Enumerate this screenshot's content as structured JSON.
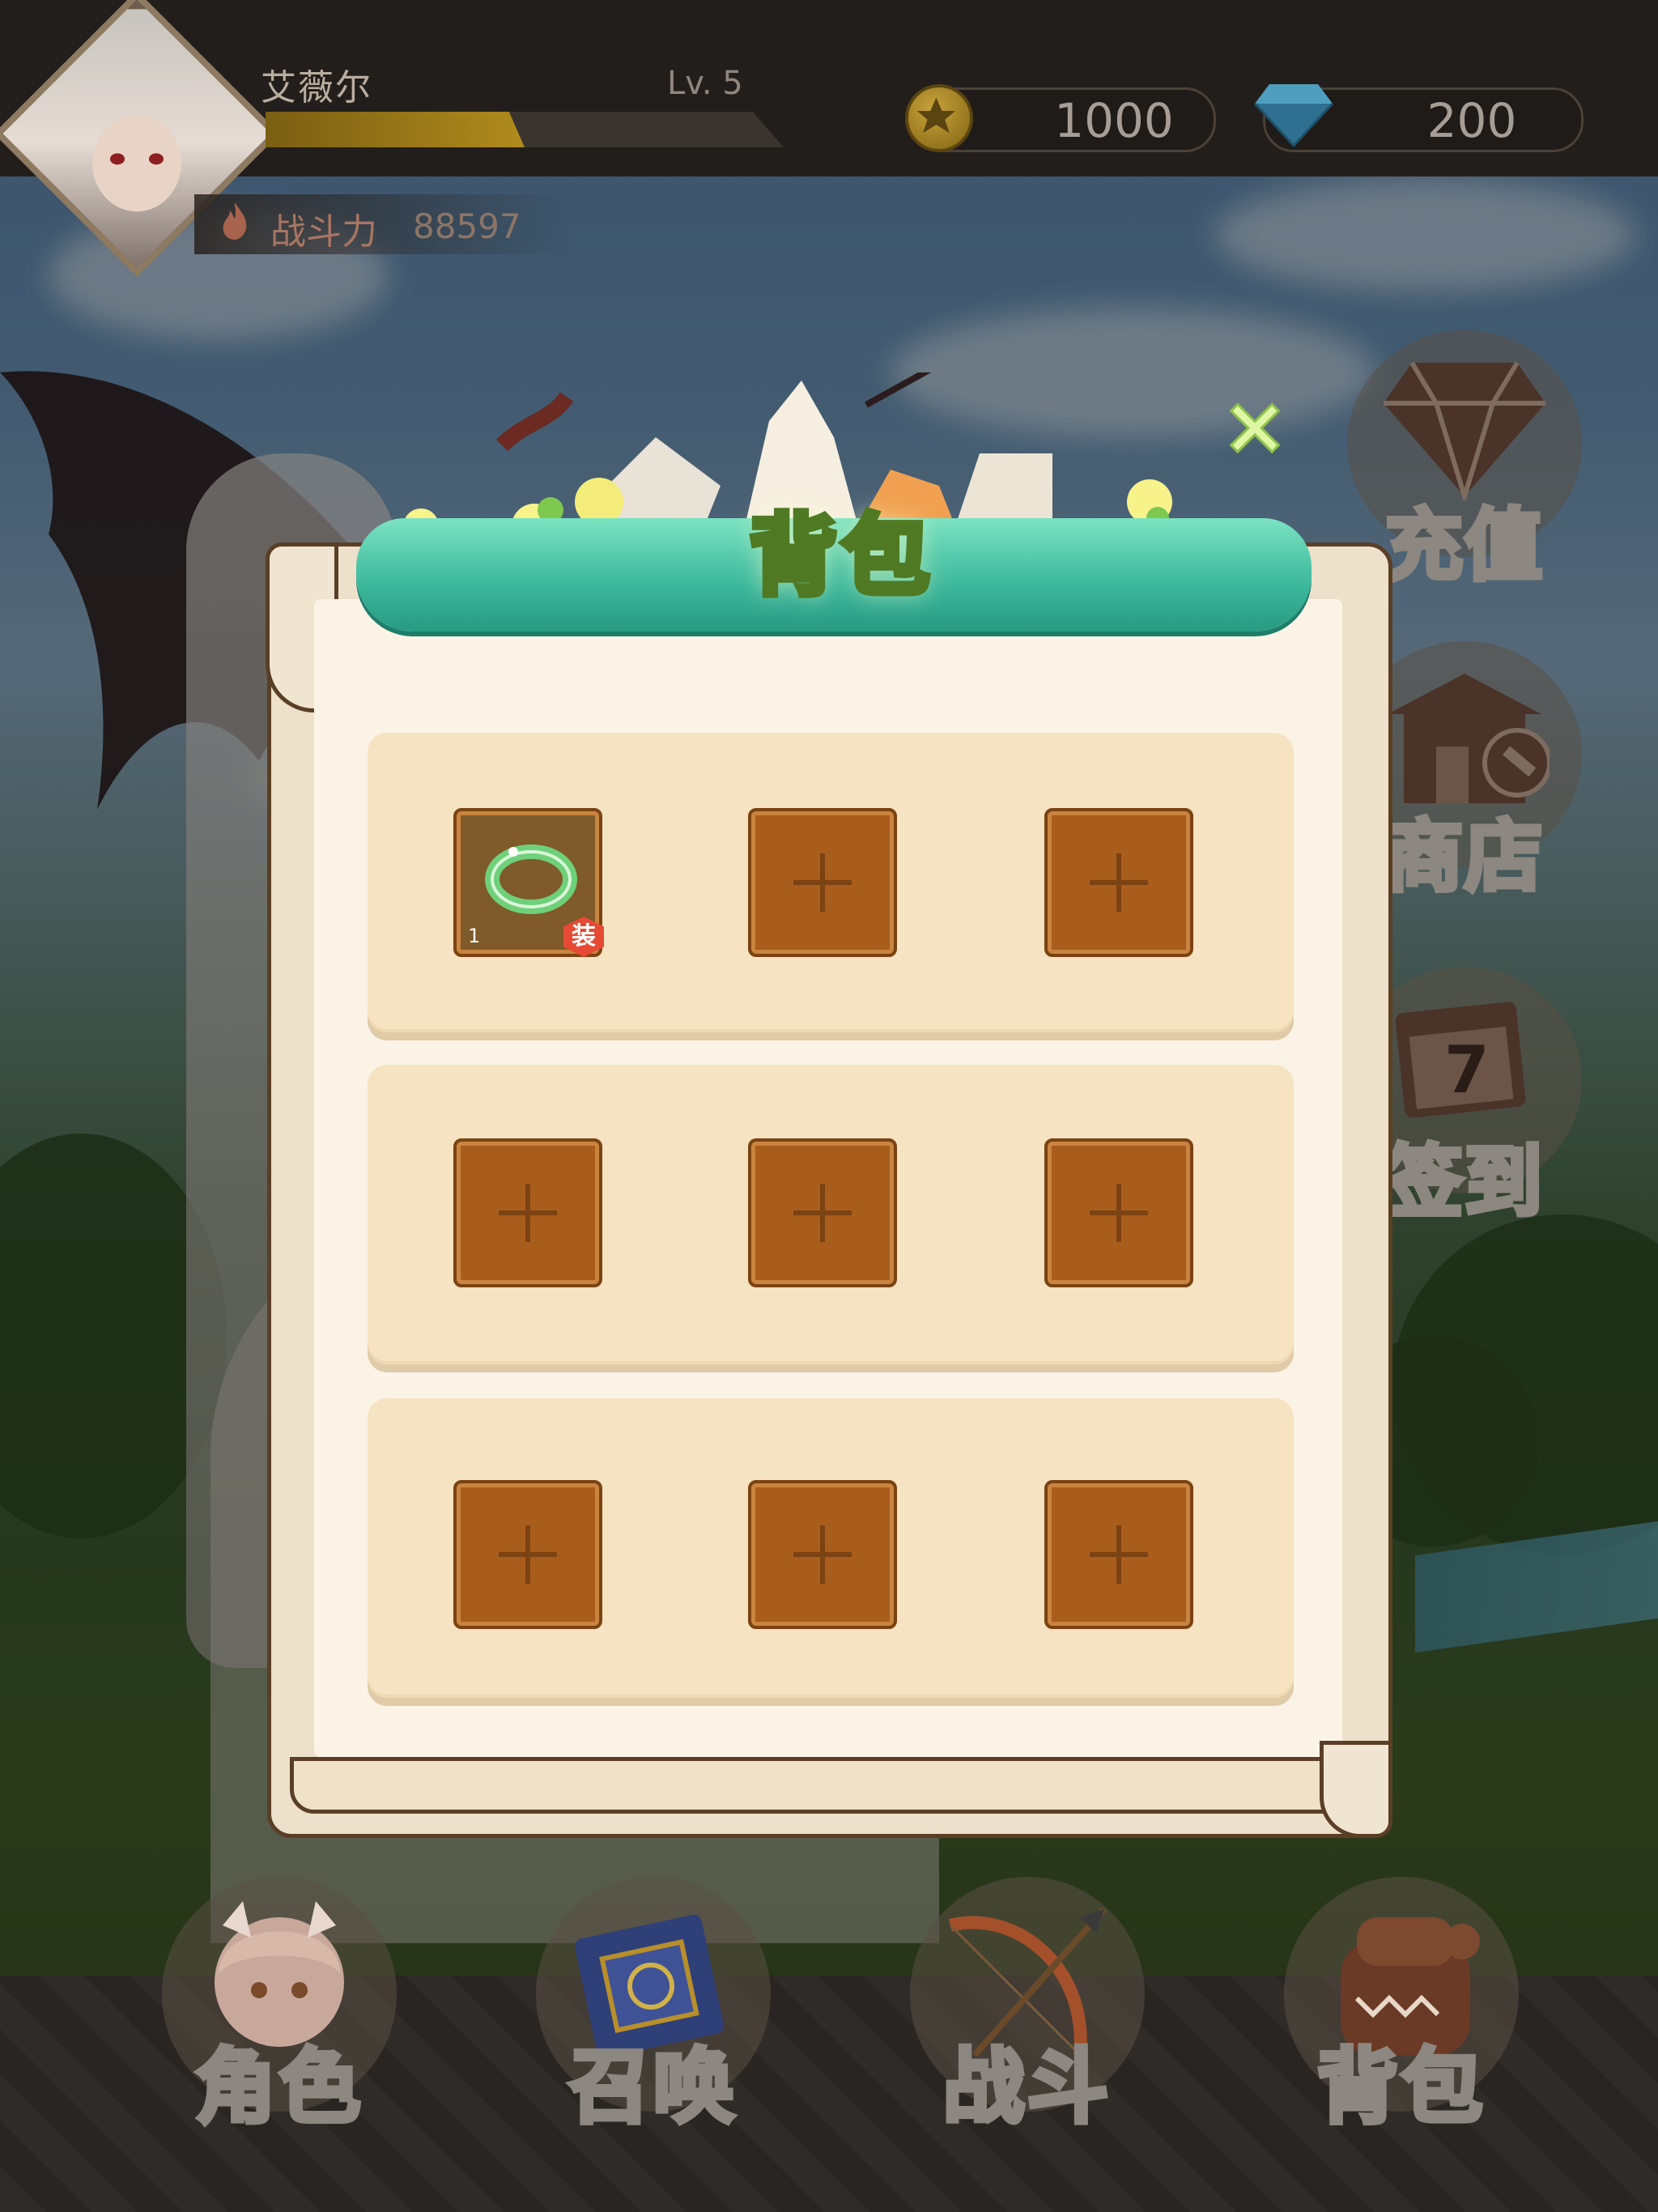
{
  "player": {
    "name": "艾薇尔",
    "level": "Lv. 5",
    "xp_fraction": 0.5,
    "power_label": "战斗力",
    "power_value": "88597"
  },
  "currency": {
    "gold": "1000",
    "diamond": "200"
  },
  "side_menu": [
    {
      "label": "充值",
      "icon": "diamond-icon"
    },
    {
      "label": "商店",
      "icon": "shop-icon"
    },
    {
      "label": "签到",
      "icon": "calendar-icon",
      "badge": "7"
    }
  ],
  "bag": {
    "title": "背包",
    "close_symbol": "×",
    "slots": [
      {
        "item": "jade-ring",
        "count": "1",
        "tag": "装"
      },
      {
        "item": null
      },
      {
        "item": null
      },
      {
        "item": null
      },
      {
        "item": null
      },
      {
        "item": null
      },
      {
        "item": null
      },
      {
        "item": null
      },
      {
        "item": null
      }
    ]
  },
  "bottom_nav": [
    {
      "label": "角色",
      "icon": "character-icon"
    },
    {
      "label": "召唤",
      "icon": "summon-book-icon"
    },
    {
      "label": "战斗",
      "icon": "bow-icon"
    },
    {
      "label": "背包",
      "icon": "backpack-icon"
    }
  ],
  "colors": {
    "panel_cream": "#fbf4e6",
    "row_bg": "#f6e3c2",
    "slot_brown": "#a95d1d",
    "header_teal": "#3bb79b",
    "title_outline": "#4f7a23",
    "xp_gold": "#b08b1d"
  }
}
